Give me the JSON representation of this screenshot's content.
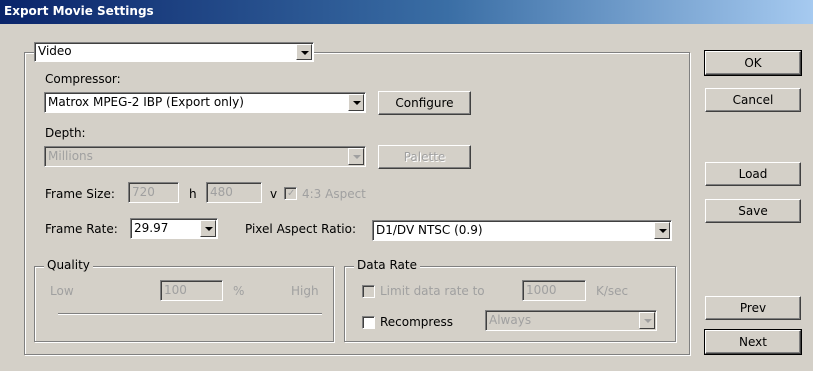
{
  "window": {
    "title": "Export Movie Settings"
  },
  "video_group": {
    "selector": "Video"
  },
  "compressor": {
    "label": "Compressor:",
    "value": "Matrox MPEG-2 IBP (Export only)",
    "configure": "Configure"
  },
  "depth": {
    "label": "Depth:",
    "value": "Millions",
    "palette": "Palette"
  },
  "frame_size": {
    "label": "Frame Size:",
    "width": "720",
    "h": "h",
    "height": "480",
    "v": "v",
    "aspect_label": "4:3 Aspect"
  },
  "frame_rate": {
    "label": "Frame Rate:",
    "value": "29.97"
  },
  "pixel_aspect": {
    "label": "Pixel Aspect Ratio:",
    "value": "D1/DV NTSC (0.9)"
  },
  "quality": {
    "legend": "Quality",
    "low": "Low",
    "value": "100",
    "percent": "%",
    "high": "High"
  },
  "data_rate": {
    "legend": "Data Rate",
    "limit_label": "Limit data rate to",
    "limit_value": "1000",
    "unit": "K/sec",
    "recompress_label": "Recompress",
    "recompress_value": "Always"
  },
  "buttons": {
    "ok": "OK",
    "cancel": "Cancel",
    "load": "Load",
    "save": "Save",
    "prev": "Prev",
    "next": "Next"
  }
}
